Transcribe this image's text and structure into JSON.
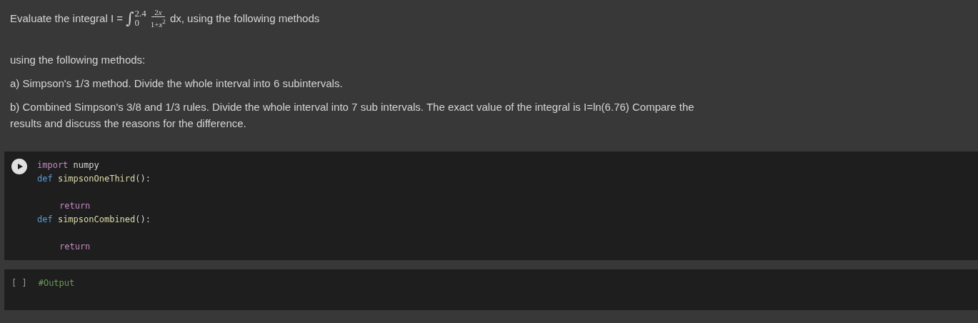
{
  "text_cell": {
    "heading": {
      "intro": "Evaluate the integral I =",
      "integral_sign": "∫",
      "upper_limit": "2.4",
      "lower_limit": "0",
      "numerator": {
        "coefficient": "2",
        "variable": "x"
      },
      "denominator": "1+*x*$^{2}$",
      "after": "dx, using the following methods"
    },
    "paragraphs": [
      "using the following methods:",
      "a) Simpson's 1/3 method. Divide the whole interval into 6 subintervals.",
      "b) Combined Simpson's 3/8 and 1/3 rules. Divide the whole interval into 7 sub intervals. The exact value of the integral is I=ln(6.76) Compare the results and discuss the reasons for the difference."
    ]
  },
  "code_cell": {
    "lines": [
      {
        "kind": "code",
        "indented": false,
        "tokens": [
          {
            "kind": "import",
            "text": "import"
          },
          {
            "kind": "name",
            "text": "numpy"
          }
        ]
      },
      {
        "kind": "code",
        "indented": false,
        "tokens": [
          {
            "kind": "def",
            "text": "def"
          },
          {
            "kind": "func",
            "text": "simpsonOneThird"
          },
          {
            "kind": "punct",
            "text": "():"
          }
        ]
      },
      {
        "kind": "blank"
      },
      {
        "kind": "code",
        "indented": true,
        "tokens": [
          {
            "kind": "import",
            "text": "return"
          }
        ]
      },
      {
        "kind": "code",
        "indented": false,
        "tokens": [
          {
            "kind": "def",
            "text": "def"
          },
          {
            "kind": "func",
            "text": "simpsonCombined"
          },
          {
            "kind": "punct",
            "text": "():"
          }
        ]
      },
      {
        "kind": "blank"
      },
      {
        "kind": "code",
        "indented": true,
        "tokens": [
          {
            "kind": "import",
            "text": "return"
          }
        ]
      }
    ]
  },
  "output_cell": {
    "prompt": "[ ]",
    "lines": [
      {
        "kind": "comment",
        "text": "#Output"
      }
    ]
  }
}
